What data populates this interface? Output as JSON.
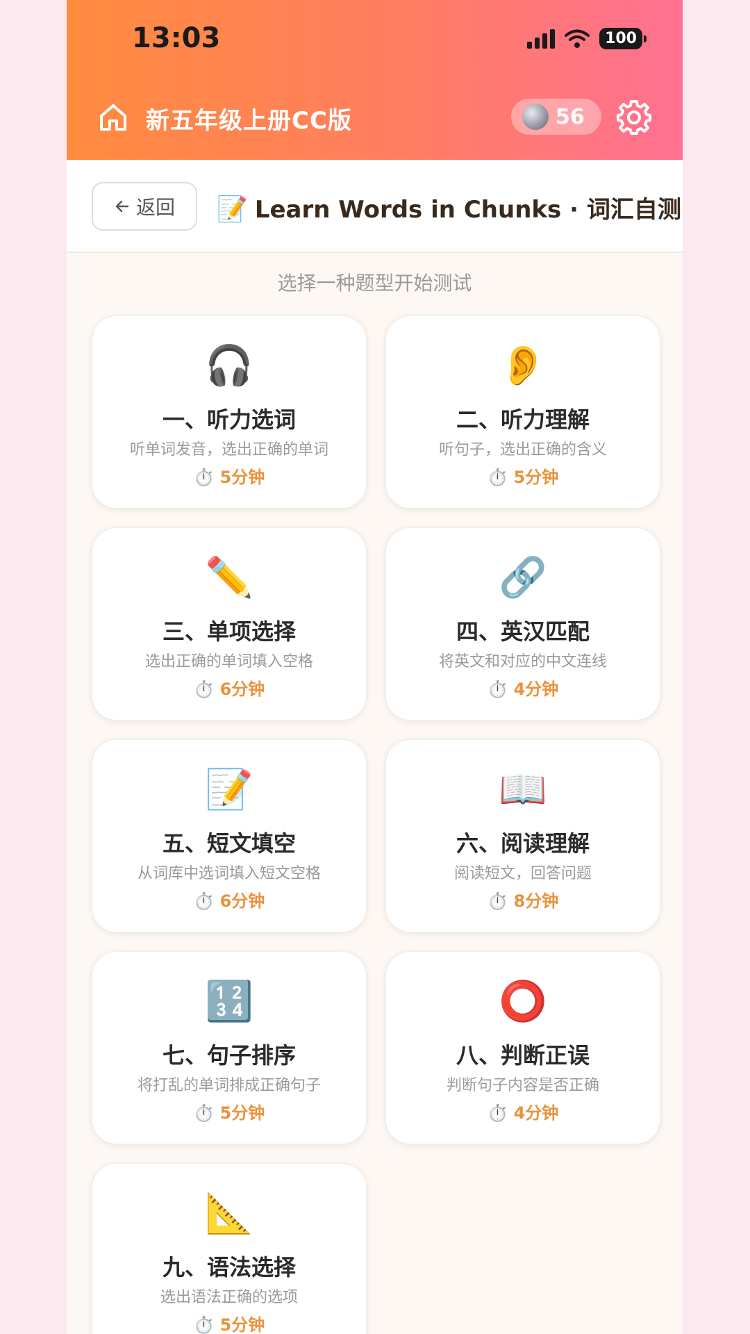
{
  "status": {
    "time": "13:03",
    "battery": "100"
  },
  "app": {
    "title": "新五年级上册CC版",
    "coins": "56"
  },
  "header": {
    "back_label": "返回",
    "title_emoji": "📝",
    "title": "Learn Words in Chunks · 词汇自测"
  },
  "subtitle": "选择一种题型开始测试",
  "cards": [
    {
      "icon": "🎧",
      "title": "一、听力选词",
      "desc": "听单词发音，选出正确的单词",
      "time": "5分钟"
    },
    {
      "icon": "👂",
      "title": "二、听力理解",
      "desc": "听句子，选出正确的含义",
      "time": "5分钟"
    },
    {
      "icon": "✏️",
      "title": "三、单项选择",
      "desc": "选出正确的单词填入空格",
      "time": "6分钟"
    },
    {
      "icon": "🔗",
      "title": "四、英汉匹配",
      "desc": "将英文和对应的中文连线",
      "time": "4分钟"
    },
    {
      "icon": "📝",
      "title": "五、短文填空",
      "desc": "从词库中选词填入短文空格",
      "time": "6分钟"
    },
    {
      "icon": "📖",
      "title": "六、阅读理解",
      "desc": "阅读短文，回答问题",
      "time": "8分钟"
    },
    {
      "icon": "🔢",
      "title": "七、句子排序",
      "desc": "将打乱的单词排成正确句子",
      "time": "5分钟"
    },
    {
      "icon": "⭕",
      "title": "八、判断正误",
      "desc": "判断句子内容是否正确",
      "time": "4分钟"
    },
    {
      "icon": "📐",
      "title": "九、语法选择",
      "desc": "选出语法正确的选项",
      "time": "5分钟"
    }
  ],
  "stopwatch_glyph": "⏱️",
  "icons": {
    "home": "home-icon",
    "settings": "gear-icon",
    "coin": "coin-icon",
    "back_arrow": "arrow-left-icon"
  },
  "colors": {
    "accent": "#e8943f",
    "gradient_start": "#ff8b3e",
    "gradient_end": "#ff7092"
  }
}
